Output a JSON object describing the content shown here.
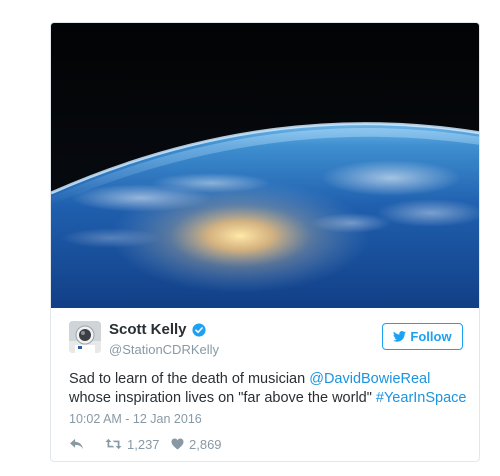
{
  "tweet": {
    "author": {
      "display_name": "Scott Kelly",
      "handle": "@StationCDRKelly",
      "verified": true,
      "avatar_icon": "astronaut-avatar"
    },
    "follow_button": {
      "icon": "twitter-bird-icon",
      "label": "Follow"
    },
    "text": {
      "part1": "Sad to learn of the death of musician ",
      "mention": "@DavidBowieReal",
      "part2": " whose inspiration lives on \"far above the world\" ",
      "hashtag": "#YearInSpace"
    },
    "timestamp": "10:02 AM - 12 Jan 2016",
    "actions": {
      "reply_icon": "reply-icon",
      "retweet_icon": "retweet-icon",
      "retweet_count": "1,237",
      "like_icon": "heart-icon",
      "like_count": "2,869"
    },
    "media": {
      "subject": "earth-horizon-from-space-photo"
    }
  },
  "colors": {
    "accent": "#1da1f2",
    "link": "#1b95e0",
    "text": "#292f33",
    "muted": "#8899a6",
    "border": "#e1e8ed",
    "space": "#05080c"
  }
}
